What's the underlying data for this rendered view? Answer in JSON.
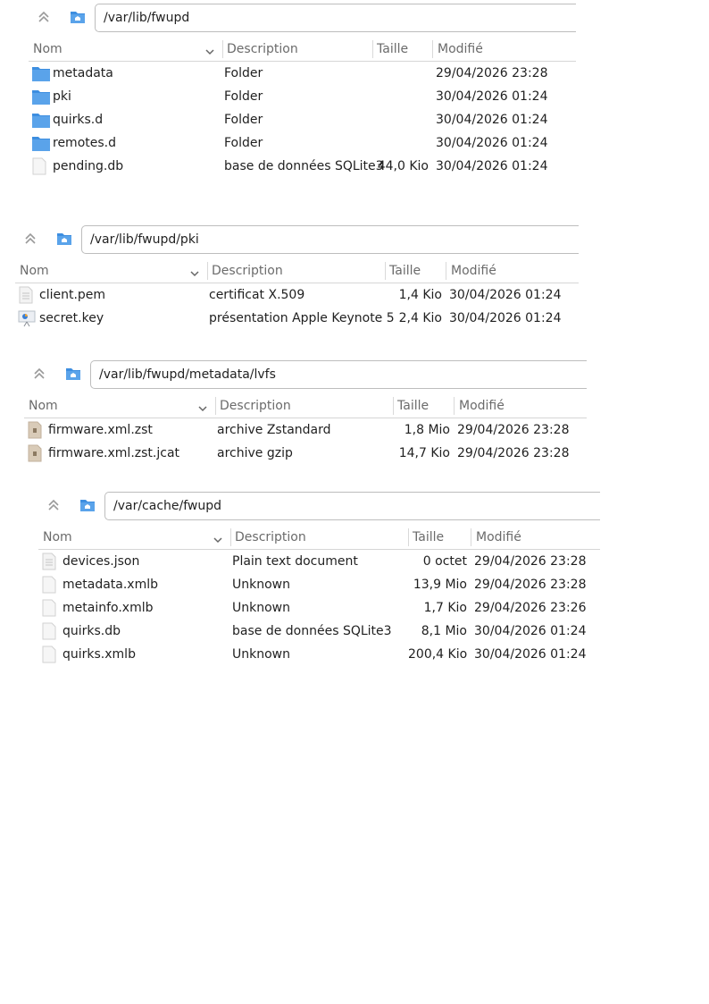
{
  "columns": {
    "name": "Nom",
    "description": "Description",
    "size": "Taille",
    "modified": "Modifié"
  },
  "colors": {
    "folder": "#4a90d9",
    "folder_dark": "#2e7bd0",
    "border": "#bdbdbd"
  },
  "panes": [
    {
      "path": "/var/lib/fwupd",
      "rows": [
        {
          "icon": "folder-icon",
          "name": "metadata",
          "description": "Folder",
          "size": "",
          "modified": "29/04/2026 23:28"
        },
        {
          "icon": "folder-icon",
          "name": "pki",
          "description": "Folder",
          "size": "",
          "modified": "30/04/2026 01:24"
        },
        {
          "icon": "folder-icon",
          "name": "quirks.d",
          "description": "Folder",
          "size": "",
          "modified": "30/04/2026 01:24"
        },
        {
          "icon": "folder-icon",
          "name": "remotes.d",
          "description": "Folder",
          "size": "",
          "modified": "30/04/2026 01:24"
        },
        {
          "icon": "file-icon",
          "name": "pending.db",
          "description": "base de données SQLite3",
          "size": "44,0 Kio",
          "modified": "30/04/2026 01:24"
        }
      ]
    },
    {
      "path": "/var/lib/fwupd/pki",
      "rows": [
        {
          "icon": "text-file-icon",
          "name": "client.pem",
          "description": "certificat X.509",
          "size": "1,4 Kio",
          "modified": "30/04/2026 01:24"
        },
        {
          "icon": "presentation-file-icon",
          "name": "secret.key",
          "description": "présentation Apple Keynote 5",
          "size": "2,4 Kio",
          "modified": "30/04/2026 01:24"
        }
      ]
    },
    {
      "path": "/var/lib/fwupd/metadata/lvfs",
      "rows": [
        {
          "icon": "archive-file-icon",
          "name": "firmware.xml.zst",
          "description": "archive Zstandard",
          "size": "1,8 Mio",
          "modified": "29/04/2026 23:28"
        },
        {
          "icon": "archive-file-icon",
          "name": "firmware.xml.zst.jcat",
          "description": "archive gzip",
          "size": "14,7 Kio",
          "modified": "29/04/2026 23:28"
        }
      ]
    },
    {
      "path": "/var/cache/fwupd",
      "rows": [
        {
          "icon": "text-file-icon",
          "name": "devices.json",
          "description": "Plain text document",
          "size": "0 octet",
          "modified": "29/04/2026 23:28"
        },
        {
          "icon": "file-icon",
          "name": "metadata.xmlb",
          "description": "Unknown",
          "size": "13,9 Mio",
          "modified": "29/04/2026 23:28"
        },
        {
          "icon": "file-icon",
          "name": "metainfo.xmlb",
          "description": "Unknown",
          "size": "1,7 Kio",
          "modified": "29/04/2026 23:26"
        },
        {
          "icon": "file-icon",
          "name": "quirks.db",
          "description": "base de données SQLite3",
          "size": "8,1 Mio",
          "modified": "30/04/2026 01:24"
        },
        {
          "icon": "file-icon",
          "name": "quirks.xmlb",
          "description": "Unknown",
          "size": "200,4 Kio",
          "modified": "30/04/2026 01:24"
        }
      ]
    }
  ]
}
